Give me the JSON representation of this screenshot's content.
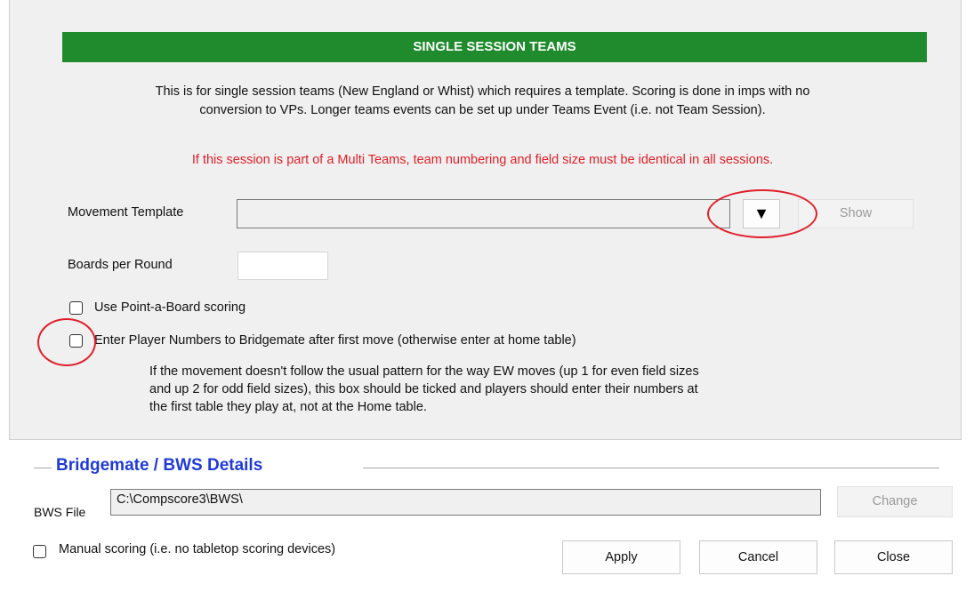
{
  "section": {
    "title": "SINGLE SESSION TEAMS",
    "description_line1": "This is for single session teams (New England or Whist) which requires a template. Scoring is done in imps with no",
    "description_line2": "conversion to VPs. Longer teams events can be set up under Teams Event (i.e. not Team Session).",
    "warning": "If this session is part of a Multi Teams, team numbering and field size must be identical in all sessions."
  },
  "movement_template": {
    "label": "Movement Template",
    "value": "",
    "dropdown_glyph": "▼",
    "show_label": "Show"
  },
  "boards_per_round": {
    "label": "Boards per Round",
    "value": ""
  },
  "point_a_board": {
    "label": "Use Point-a-Board scoring",
    "checked": false
  },
  "enter_player_numbers": {
    "label": "Enter Player Numbers to Bridgemate after first move (otherwise enter at home table)",
    "checked": false,
    "note_line1": "If the movement doesn't follow the usual pattern for the way EW moves (up 1 for even field sizes",
    "note_line2": "and up 2 for odd field sizes), this box should be ticked and players should enter their numbers at",
    "note_line3": "the first table they play at, not at the Home table."
  },
  "bridgemate": {
    "title": "Bridgemate / BWS Details",
    "bws_file_label": "BWS File",
    "bws_file_value": "C:\\Compscore3\\BWS\\",
    "change_label": "Change"
  },
  "footer": {
    "manual_scoring_label": "Manual scoring (i.e. no tabletop scoring devices)",
    "manual_scoring_checked": false,
    "apply_label": "Apply",
    "cancel_label": "Cancel",
    "close_label": "Close"
  },
  "colors": {
    "banner": "#1f8b2d",
    "warning": "#e0202a",
    "group_title": "#1f3ad6",
    "highlight_circle": "#e0202a"
  }
}
